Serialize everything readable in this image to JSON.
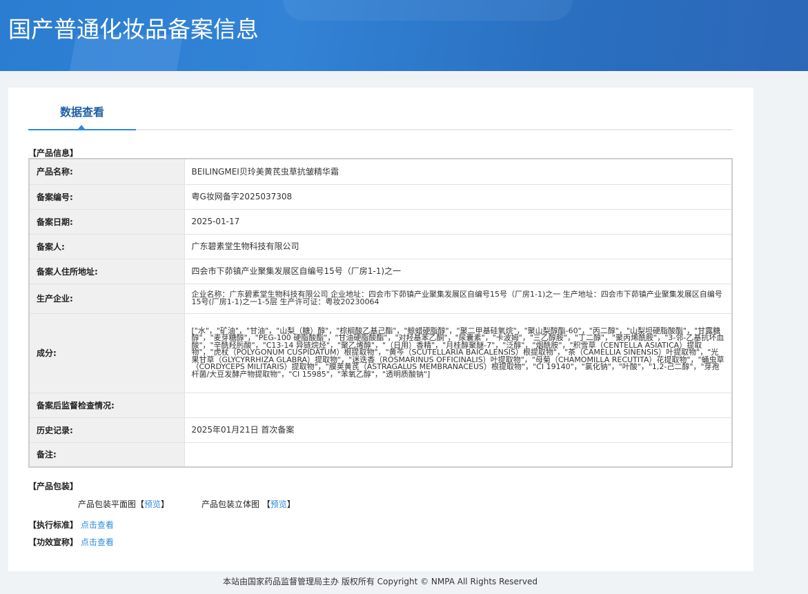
{
  "header": {
    "title": "国产普通化妆品备案信息"
  },
  "tab": {
    "label": "数据查看"
  },
  "product_info": {
    "section_title": "【产品信息】",
    "rows": [
      {
        "label": "产品名称:",
        "value": "BEILINGMEI贝玲美黄芪虫草抗皱精华霜"
      },
      {
        "label": "备案编号:",
        "value": "粤G妆网备字2025037308"
      },
      {
        "label": "备案日期:",
        "value": "2025-01-17"
      },
      {
        "label": "备案人:",
        "value": "广东碧素堂生物科技有限公司"
      },
      {
        "label": "备案人住所地址:",
        "value": "四会市下茆镇产业聚集发展区自编号15号（厂房1-1)之一"
      },
      {
        "label": "生产企业:",
        "value": "企业名称：广东碧素堂生物科技有限公司 企业地址：四会市下茆镇产业聚集发展区自编号15号（厂房1-1)之一 生产地址：四会市下茆镇产业聚集发展区自编号15号(厂房1-1)之一1-5层 生产许可证：粤妆20230064"
      },
      {
        "label": "成分:",
        "value": "[\"水\"，\"矿油\"，\"甘油\"，\"山梨（糖）醇\"，\"棕榈酸乙基己酯\"，\"鲸蜡硬脂醇\"，\"聚二甲基硅氧烷\"，\"聚山梨醇酯-60\"，\"丙二醇\"，\"山梨坦硬脂酸酯\"，\"甘露糖醇\"，\"麦芽糖醇\"，\"PEG-100 硬脂酸酯\"，\"甘油硬脂酸酯\"，\"对羟基苯乙酮\"，\"尿囊素\"，\"卡波姆\"，\"三乙醇胺\"，\"丁二醇\"，\"聚丙烯酰胺\"，\"3-邻-乙基抗坏血酸\"，\"辛酰羟肟酸\"，\"C13-14 异链烷烃\"，\"聚乙烯醇\"，\"（日用）香精\"，\"月桂醇聚醚-7\"，\"泛醇\"，\"烟酰胺\"，\"积雪草（CENTELLA ASIATICA）提取物\"，\"虎杖（POLYGONUM CUSPIDATUM）根提取物\"，\"黄芩（SCUTELLARIA BAICALENSIS）根提取物\"，\"茶（CAMELLIA SINENSIS）叶提取物\"，\"光果甘草（GLYCYRRHIZA GLABRA）提取物\"，\"迷迭香（ROSMARINUS OFFICINALIS）叶提取物\"，\"母菊（CHAMOMILLA RECUTITA）花提取物\"，\"蛹虫草（CORDYCEPS MILITARIS）提取物\"，\"膜荚黄芪（ASTRAGALUS MEMBRANACEUS）根提取物\"，\"CI 19140\"，\"氯化钠\"，\"叶酸\"，\"1,2-己二醇\"，\"芽孢杆菌/大豆发酵产物提取物\"，\"CI 15985\"，\"苯氧乙醇\"，\"透明质酸钠\"]"
      },
      {
        "label": "备案后监督检查情况:",
        "value": ""
      },
      {
        "label": "历史记录:",
        "value": "2025年01月21日 首次备案"
      },
      {
        "label": "备注:",
        "value": ""
      }
    ]
  },
  "packaging": {
    "section_title": "【产品包装】",
    "flat_label": "产品包装平面图",
    "solid_label": "产品包装立体图",
    "preview": "预览",
    "bracket_open": "【",
    "bracket_close": "】"
  },
  "standard": {
    "label": "【执行标准】",
    "link": "点击查看"
  },
  "claims": {
    "label": "【功效宣称】",
    "link": "点击查看"
  },
  "footer": {
    "text": "本站由国家药品监督管理局主办 版权所有 Copyright © NMPA All Rights Reserved"
  }
}
